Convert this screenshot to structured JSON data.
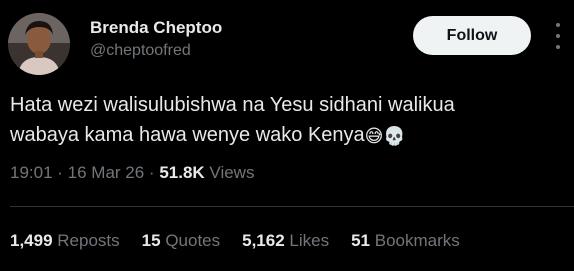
{
  "author": {
    "name": "Brenda Cheptoo",
    "handle": "@cheptoofred"
  },
  "follow_label": "Follow",
  "tweet": {
    "text_line1": "Hata wezi walisulubishwa na Yesu sidhani walikua",
    "text_line2": "wabaya kama hawa wenye wako Kenya",
    "emoji_1": "😅",
    "emoji_2": "💀"
  },
  "meta": {
    "time": "19:01",
    "sep1": " · ",
    "date": "16 Mar 26",
    "sep2": " · ",
    "views_count": "51.8K",
    "views_label": " Views"
  },
  "stats": {
    "reposts_count": "1,499",
    "reposts_label": "Reposts",
    "quotes_count": "15",
    "quotes_label": "Quotes",
    "likes_count": "5,162",
    "likes_label": "Likes",
    "bookmarks_count": "51",
    "bookmarks_label": "Bookmarks"
  },
  "colors": {
    "background": "#000000",
    "text_primary": "#e7e9ea",
    "text_secondary": "#71767b",
    "follow_bg": "#eff3f4",
    "divider": "#2f3336"
  },
  "icons": {
    "more": "more-options-icon"
  }
}
